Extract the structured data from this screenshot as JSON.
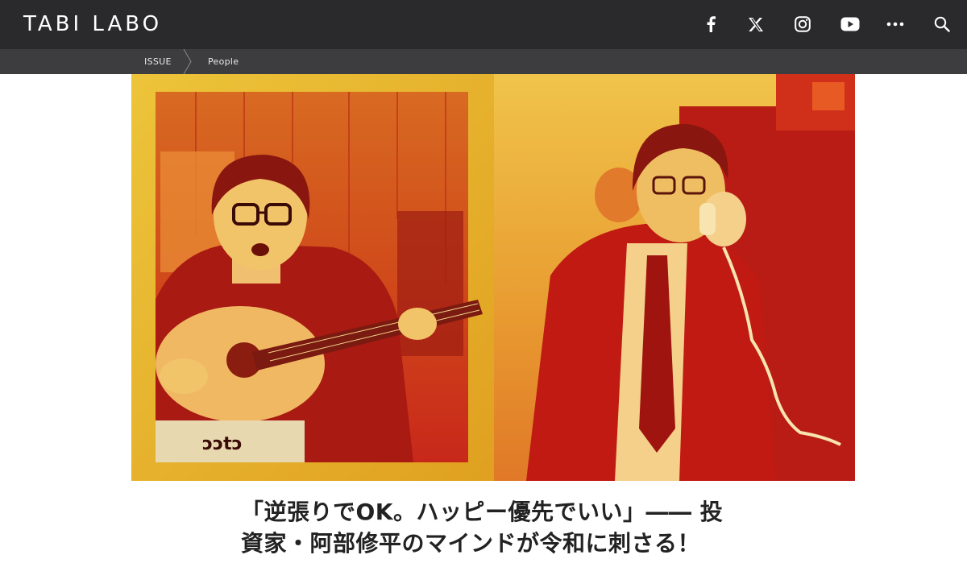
{
  "header": {
    "logo": "TABI LABO",
    "social_icons": [
      "facebook-icon",
      "x-icon",
      "instagram-icon",
      "youtube-icon",
      "more-icon",
      "search-icon"
    ]
  },
  "breadcrumb": {
    "items": [
      "ISSUE",
      "People"
    ]
  },
  "hero": {
    "icon": "hero-photo-collage"
  },
  "article": {
    "title": "「逆張りでOK。ハッピー優先でいい」―― 投資家・阿部修平のマインドが令和に刺さる！"
  },
  "colors": {
    "topbar": "#2a2a2c",
    "crumbbar": "#3d3d3f",
    "hero_yellow": "#e8c230",
    "hero_red": "#c81a12",
    "text": "#222222"
  }
}
